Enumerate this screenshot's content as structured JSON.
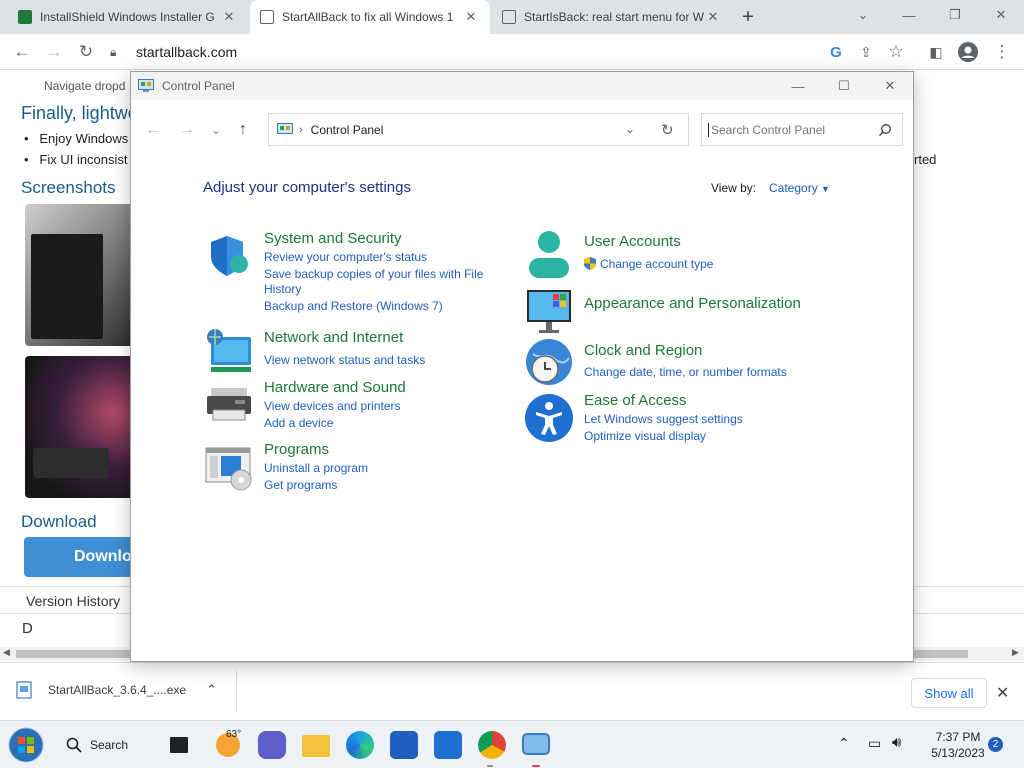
{
  "browser": {
    "tabs": [
      {
        "title": "InstallShield Windows Installer G",
        "favicon_color": "#1e7b3c"
      },
      {
        "title": "StartAllBack to fix all Windows 1",
        "favicon_color": "#5f6368"
      },
      {
        "title": "StartIsBack: real start menu for W",
        "favicon_color": "#5f6368"
      }
    ],
    "address": "startallback.com",
    "page": {
      "line1": "Navigate dropd",
      "heading": "Finally, lightwe",
      "bullet1": "Enjoy Windows",
      "bullet2": "Fix UI inconsist",
      "right_text": "rted",
      "screenshots": "Screenshots",
      "download_heading": "Download",
      "download_button": "Downlo",
      "version_history": "Version History",
      "cut_text": "D"
    }
  },
  "download_bar": {
    "file": "StartAllBack_3.6.4_....exe",
    "show_all": "Show all"
  },
  "control_panel": {
    "window_title": "Control Panel",
    "breadcrumb": "Control Panel",
    "search_placeholder": "Search Control Panel",
    "heading": "Adjust your computer's settings",
    "view_by_label": "View by:",
    "view_by_value": "Category",
    "categories": [
      {
        "title": "System and Security",
        "links": [
          "Review your computer's status",
          "Save backup copies of your files with File",
          "History",
          "Backup and Restore (Windows 7)"
        ]
      },
      {
        "title": "Network and Internet",
        "links": [
          "View network status and tasks"
        ]
      },
      {
        "title": "Hardware and Sound",
        "links": [
          "View devices and printers",
          "Add a device"
        ]
      },
      {
        "title": "Programs",
        "links": [
          "Uninstall a program",
          "Get programs"
        ]
      },
      {
        "title": "User Accounts",
        "links": [
          "Change account type"
        ]
      },
      {
        "title": "Appearance and Personalization",
        "links": []
      },
      {
        "title": "Clock and Region",
        "links": [
          "Change date, time, or number formats"
        ]
      },
      {
        "title": "Ease of Access",
        "links": [
          "Let Windows suggest settings",
          "Optimize visual display"
        ]
      }
    ],
    "colors": {
      "category_title": "#1a7a34",
      "link": "#1f5fbf",
      "heading": "#1e3287"
    }
  },
  "taskbar": {
    "search_label": "Search",
    "weather": "63°",
    "time": "7:37 PM",
    "date": "5/13/2023",
    "notifications": "2"
  }
}
